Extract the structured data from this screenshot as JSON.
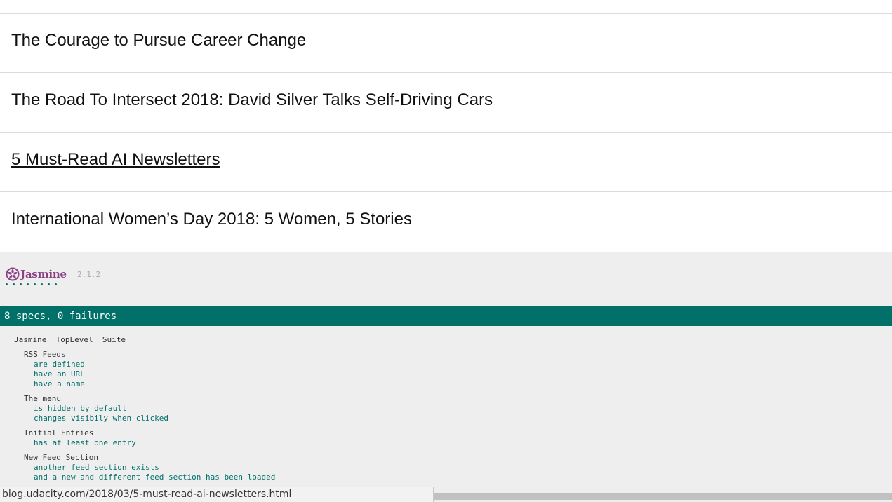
{
  "feed": {
    "entries": [
      {
        "title": "The Courage to Pursue Career Change"
      },
      {
        "title": "The Road To Intersect 2018: David Silver Talks Self-Driving Cars"
      },
      {
        "title": "5 Must-Read AI Newsletters"
      },
      {
        "title": "International Women’s Day 2018: 5 Women, 5 Stories"
      }
    ]
  },
  "jasmine": {
    "logo_text": "Jasmine",
    "logo_icon": "jasmine-flower-icon",
    "version": "2.1.2",
    "dots_count": 8,
    "summary": "8 specs, 0 failures",
    "top_suite": "Jasmine__TopLevel__Suite",
    "suites": [
      {
        "name": "RSS Feeds",
        "specs": [
          "are defined",
          "have an URL",
          "have a name"
        ]
      },
      {
        "name": "The menu",
        "specs": [
          "is hidden by default",
          "changes visibily when clicked"
        ]
      },
      {
        "name": "Initial Entries",
        "specs": [
          "has at least one entry"
        ]
      },
      {
        "name": "New Feed Section",
        "specs": [
          "another feed section exists",
          "and a new and different feed section has been loaded"
        ]
      }
    ],
    "colors": {
      "brand": "#8a4182",
      "pass": "#007069"
    }
  },
  "status_bar": {
    "url": "blog.udacity.com/2018/03/5-must-read-ai-newsletters.html"
  }
}
